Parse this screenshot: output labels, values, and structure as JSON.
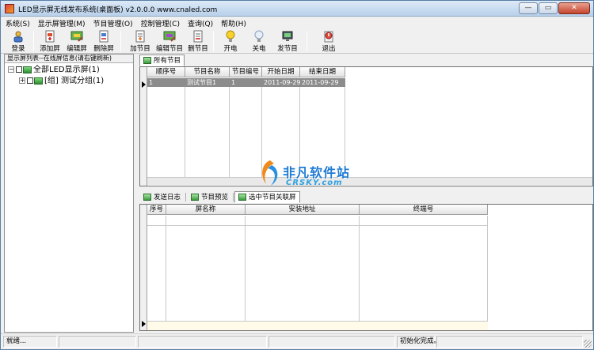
{
  "window": {
    "title": "LED显示屏无线发布系统(桌面板) v2.0.0.0  www.cnaled.com",
    "minimize": "—",
    "maximize": "▭",
    "close": "✕"
  },
  "menu": [
    "系统(S)",
    "显示屏管理(M)",
    "节目管理(O)",
    "控制管理(C)",
    "查询(Q)",
    "帮助(H)"
  ],
  "toolbar": [
    {
      "label": "登录",
      "icon": "login-icon"
    },
    {
      "label": "添加屏",
      "icon": "add-screen-icon"
    },
    {
      "label": "编辑屏",
      "icon": "edit-screen-icon"
    },
    {
      "label": "删除屏",
      "icon": "delete-screen-icon"
    },
    {
      "label": "加节目",
      "icon": "add-program-icon"
    },
    {
      "label": "编辑节目",
      "icon": "edit-program-icon"
    },
    {
      "label": "删节目",
      "icon": "delete-program-icon"
    },
    {
      "label": "开电",
      "icon": "power-on-bulb-icon"
    },
    {
      "label": "关电",
      "icon": "power-off-bulb-icon"
    },
    {
      "label": "发节目",
      "icon": "send-program-icon"
    },
    {
      "label": "退出",
      "icon": "exit-icon"
    }
  ],
  "left_panel": {
    "header": "显示屏列表--在线屏信息(请右键刷新)",
    "tree": [
      {
        "label": "全部LED显示屏(1)",
        "expander": "−"
      },
      {
        "label": "[组] 测试分组(1)",
        "expander": "+"
      }
    ]
  },
  "programs": {
    "tab": "所有节目",
    "columns": [
      "顺序号",
      "节目名称",
      "节目编号",
      "开始日期",
      "结束日期"
    ],
    "rows": [
      [
        "1",
        "测试节目1",
        "1",
        "2011-09-29",
        "2011-09-29"
      ]
    ]
  },
  "bottom_tabs": [
    "发送日志",
    "节目预览",
    "选中节目关联屏"
  ],
  "screens_grid": {
    "columns": [
      "序号",
      "屏名称",
      "安装地址",
      "终端号"
    ]
  },
  "watermark": {
    "text1": "非凡软件站",
    "text2": "CRSKY.com"
  },
  "status": {
    "left": "就绪...",
    "middle": "初始化完成。"
  },
  "colors": {
    "title_bar": "#c6daf0",
    "selected_row": "#8c8c8c",
    "watermark_blue": "#1f7bd4"
  }
}
